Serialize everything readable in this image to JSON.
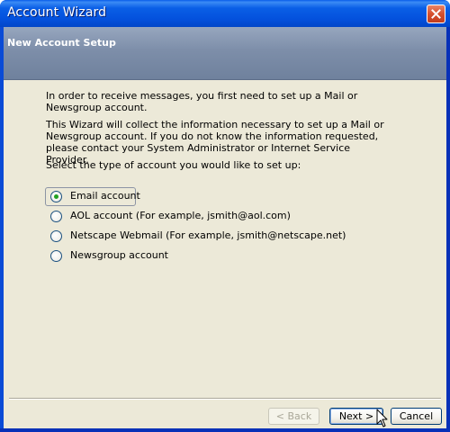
{
  "window": {
    "title": "Account Wizard",
    "close_icon": "close-icon"
  },
  "header": {
    "title": "New Account Setup"
  },
  "content": {
    "intro": "In order to receive messages, you first need to set up a Mail or Newsgroup account.",
    "info": "This Wizard will collect the information necessary to set up a Mail or Newsgroup account. If you do not know the information requested, please contact your System Administrator or Internet Service Provider.",
    "prompt": "Select the type of account you would like to set up:"
  },
  "account_types": [
    {
      "label": "Email account",
      "selected": true
    },
    {
      "label": "AOL account (For example, jsmith@aol.com)",
      "selected": false
    },
    {
      "label": "Netscape Webmail (For example, jsmith@netscape.net)",
      "selected": false
    },
    {
      "label": "Newsgroup account",
      "selected": false
    }
  ],
  "buttons": {
    "back": "< Back",
    "next": "Next >",
    "cancel": "Cancel"
  },
  "colors": {
    "titlebar": "#0a5fe6",
    "header": "#7d8ea9",
    "radio_selected": "#21a121",
    "client_bg": "#ece9d8"
  }
}
